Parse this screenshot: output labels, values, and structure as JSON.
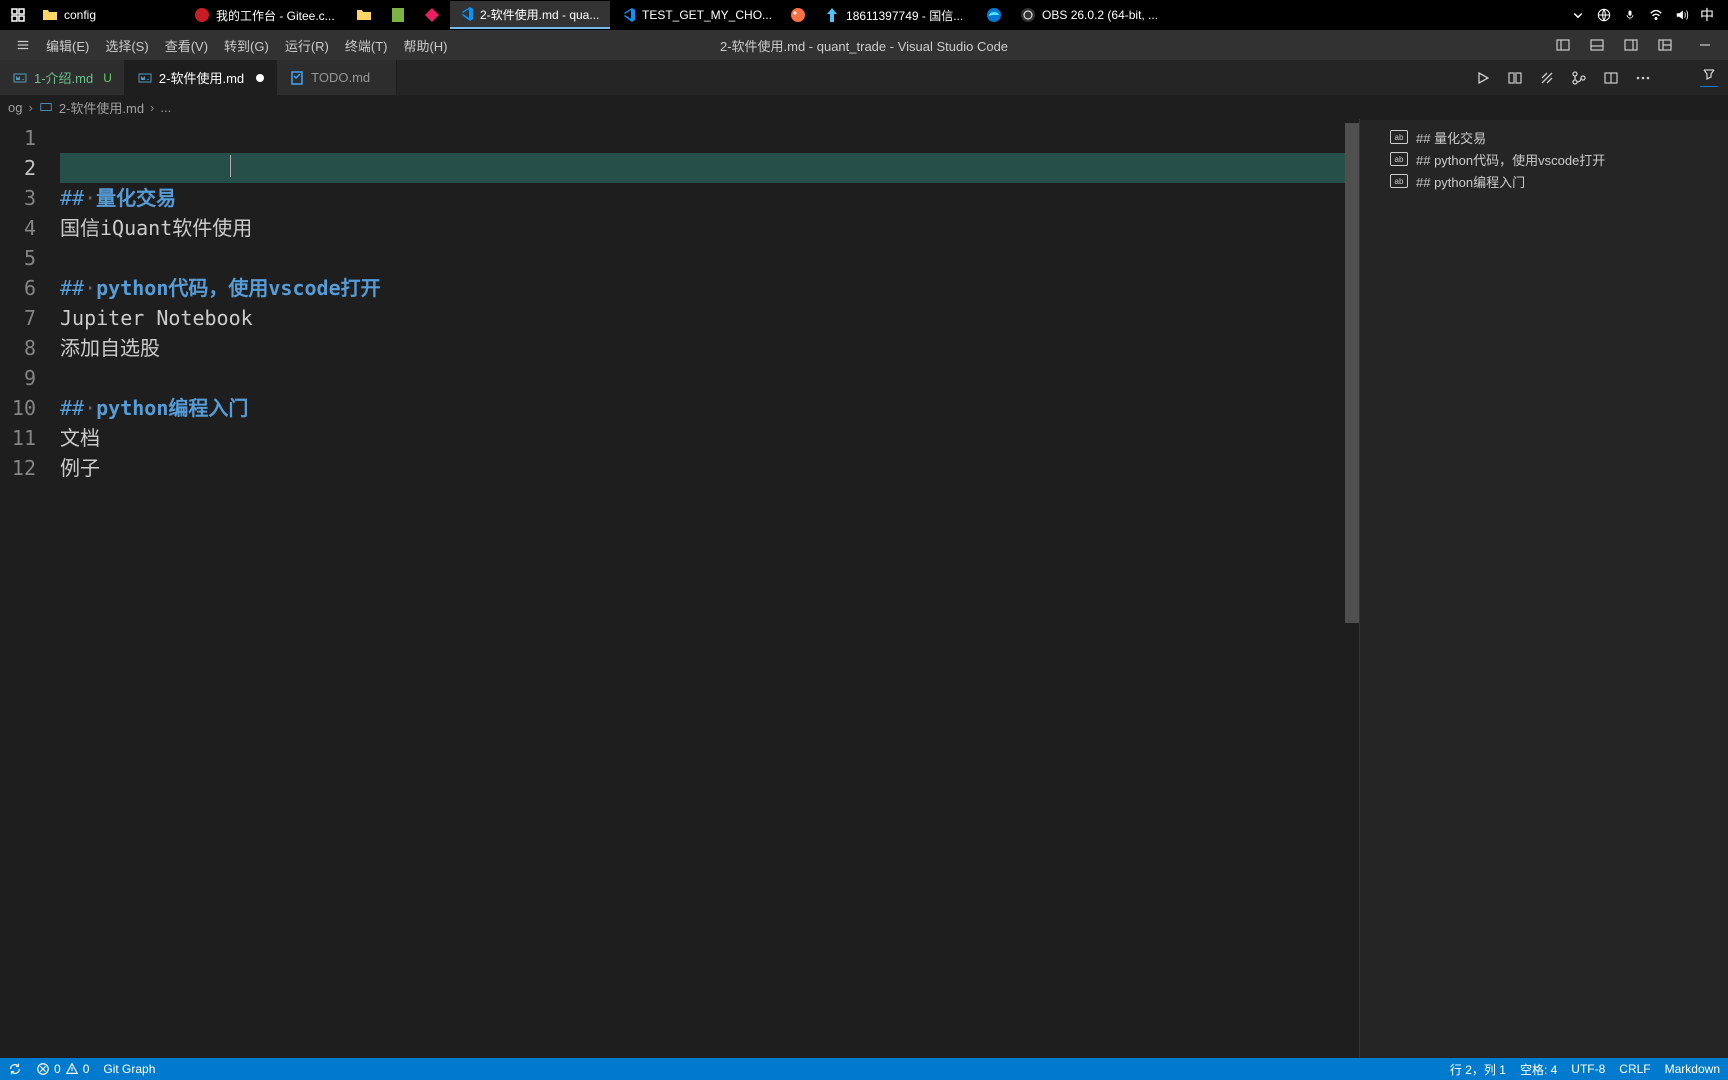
{
  "taskbar": {
    "items": [
      {
        "label": "config",
        "kind": "folder"
      },
      {
        "label": "我的工作台 - Gitee.c...",
        "kind": "browser"
      },
      {
        "label": "",
        "kind": "blank-folder"
      },
      {
        "label": "",
        "kind": "blank-folder2"
      },
      {
        "label": "",
        "kind": "app-diamond"
      },
      {
        "label": "2-软件使用.md - qua...",
        "kind": "vscode",
        "active": true
      },
      {
        "label": "TEST_GET_MY_CHO...",
        "kind": "vscode"
      },
      {
        "label": "",
        "kind": "palette"
      },
      {
        "label": "18611397749 - 国信...",
        "kind": "stock"
      },
      {
        "label": "",
        "kind": "edge"
      },
      {
        "label": "OBS 26.0.2 (64-bit, ...",
        "kind": "obs"
      }
    ],
    "ime": "中"
  },
  "menu": [
    "编辑(E)",
    "选择(S)",
    "查看(V)",
    "转到(G)",
    "运行(R)",
    "终端(T)",
    "帮助(H)"
  ],
  "window_title": "2-软件使用.md - quant_trade - Visual Studio Code",
  "tabs": [
    {
      "label": "1-介绍.md",
      "status": "U",
      "active": false
    },
    {
      "label": "2-软件使用.md",
      "modified": true,
      "active": true
    },
    {
      "label": "TODO.md",
      "active": false
    }
  ],
  "breadcrumb": {
    "p1": "og",
    "p2": "2-软件使用.md",
    "p3": "..."
  },
  "editor": {
    "lines": [
      {
        "n": 1,
        "text": ""
      },
      {
        "n": 2,
        "text": "",
        "sel": true
      },
      {
        "n": 3,
        "hash": "##",
        "heading": "量化交易"
      },
      {
        "n": 4,
        "text": "国信iQuant软件使用"
      },
      {
        "n": 5,
        "text": ""
      },
      {
        "n": 6,
        "hash": "##",
        "heading": "python代码，使用vscode打开"
      },
      {
        "n": 7,
        "text": "Jupiter Notebook"
      },
      {
        "n": 8,
        "text": "添加自选股"
      },
      {
        "n": 9,
        "text": ""
      },
      {
        "n": 10,
        "hash": "##",
        "heading": "python编程入门"
      },
      {
        "n": 11,
        "text": "文档"
      },
      {
        "n": 12,
        "text": "例子"
      }
    ]
  },
  "outline": {
    "items": [
      "## 量化交易",
      "## python代码，使用vscode打开",
      "## python编程入门"
    ]
  },
  "status": {
    "sync": "",
    "errors": "0",
    "warnings": "0",
    "git_graph": "Git Graph",
    "cursor": "行 2，列 1",
    "spaces": "空格: 4",
    "encoding": "UTF-8",
    "eol": "CRLF",
    "lang": "Markdown"
  }
}
